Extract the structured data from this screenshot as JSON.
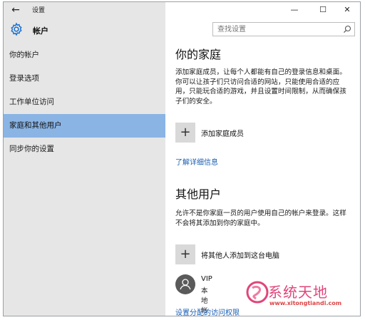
{
  "window": {
    "title": "设置",
    "back_glyph": "←",
    "controls": {
      "minimize": "—",
      "maximize": "☐",
      "close": "✕"
    }
  },
  "header": {
    "icon": "gear-icon",
    "title": "帐户"
  },
  "search": {
    "placeholder": "查找设置",
    "icon": "search-icon"
  },
  "sidebar": {
    "items": [
      {
        "label": "你的帐户",
        "active": false
      },
      {
        "label": "登录选项",
        "active": false
      },
      {
        "label": "工作单位访问",
        "active": false
      },
      {
        "label": "家庭和其他用户",
        "active": true
      },
      {
        "label": "同步你的设置",
        "active": false
      }
    ]
  },
  "family": {
    "title": "你的家庭",
    "description": "添加家庭成员，让每个人都能有自己的登录信息和桌面。你可以让孩子们只访问合适的网站，只能使用合适的应用，只能玩合适的游戏，并且设置时间限制，从而确保孩子们的安全。",
    "add_label": "添加家庭成员",
    "add_glyph": "+",
    "learn_more": "了解详细信息"
  },
  "others": {
    "title": "其他用户",
    "description": "允许不是你家庭一员的用户使用自己的帐户来登录。这样不会将其添加到你的家庭中。",
    "add_label": "将其他人添加到这台电脑",
    "add_glyph": "+",
    "user": {
      "name": "VIP",
      "type": "本地帐户"
    },
    "assigned_access": "设置分配的访问权限"
  },
  "watermark": {
    "text": "系统天地",
    "url": "www.xitongtiandi.com"
  },
  "colors": {
    "accent": "#8ab4e4",
    "link": "#1a5fb4",
    "sidebar_bg": "#e6e6e6"
  }
}
